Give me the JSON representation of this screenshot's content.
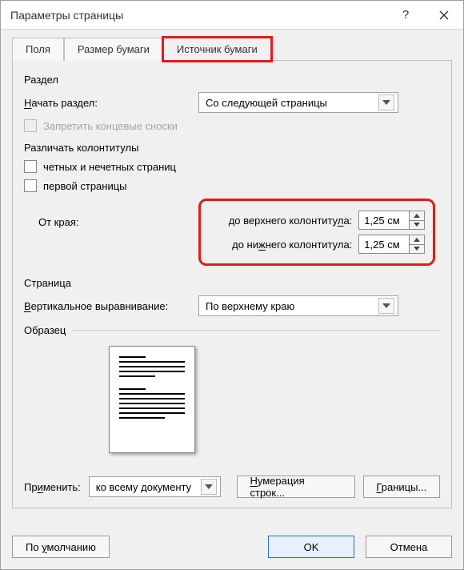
{
  "window": {
    "title": "Параметры страницы"
  },
  "tabs": [
    {
      "label": "Поля"
    },
    {
      "label": "Размер бумаги"
    },
    {
      "label": "Источник бумаги"
    }
  ],
  "section_razdel": {
    "title": "Раздел",
    "start_label": "Начать раздел:",
    "start_value": "Со следующей страницы",
    "suppress_endnotes": "Запретить концевые сноски"
  },
  "headers_footers": {
    "title": "Различать колонтитулы",
    "odd_even": "четных и нечетных страниц",
    "first_page": "первой страницы",
    "from_edge": "От края:",
    "header_label": "до верхнего колонтитула:",
    "header_value": "1,25 см",
    "footer_label": "до нижнего колонтитула:",
    "footer_value": "1,25 см"
  },
  "page": {
    "title": "Страница",
    "valign_label": "Вертикальное выравнивание:",
    "valign_value": "По верхнему краю"
  },
  "preview": {
    "title": "Образец"
  },
  "apply": {
    "label": "Применить:",
    "value": "ко всему документу",
    "line_numbers": "Нумерация строк...",
    "borders": "Границы..."
  },
  "footer": {
    "default": "По умолчанию",
    "ok": "OK",
    "cancel": "Отмена"
  }
}
